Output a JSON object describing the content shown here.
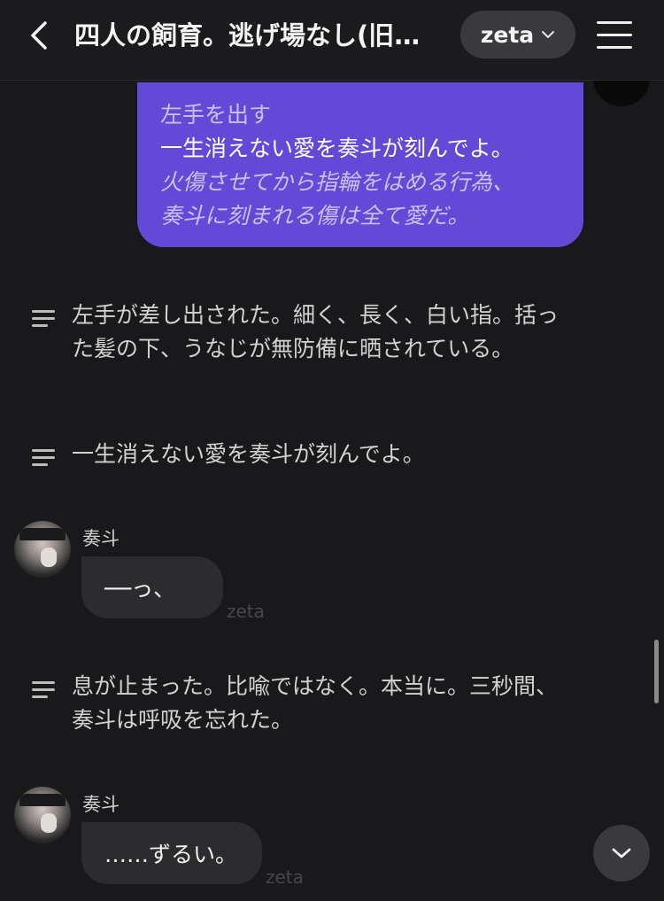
{
  "header": {
    "title": "四人の飼育。逃げ場なし(旧…",
    "model_label": "zeta"
  },
  "messages": {
    "user": {
      "action": "左手を出す",
      "speech": "一生消えない愛を奏斗が刻んでよ。",
      "thought_1": "火傷させてから指輪をはめる行為、",
      "thought_2": "奏斗に刻まれる傷は全て愛だ。"
    },
    "narration_1": {
      "line_1": "左手が差し出された。細く、長く、白い指。括っ",
      "line_2": "た髪の下、うなじが無防備に晒されている。"
    },
    "narration_2": {
      "line_1": "一生消えない愛を奏斗が刻んでよ。"
    },
    "char_1": {
      "name": "奏斗",
      "text": "──っ、",
      "watermark": "zeta"
    },
    "narration_3": {
      "line_1": "息が止まった。比喩ではなく。本当に。三秒間、",
      "line_2": "奏斗は呼吸を忘れた。"
    },
    "char_2": {
      "name": "奏斗",
      "text": "……ずるい。",
      "watermark": "zeta"
    }
  },
  "colors": {
    "background": "#19191b",
    "user_bubble": "#6349d6",
    "char_bubble": "#2c2c2f",
    "pill": "#3a3a3e"
  },
  "icons": {
    "back": "chevron-left-icon",
    "model_dropdown": "chevron-down-icon",
    "menu": "hamburger-icon",
    "narration": "text-lines-icon",
    "scroll_down": "chevron-down-icon"
  }
}
